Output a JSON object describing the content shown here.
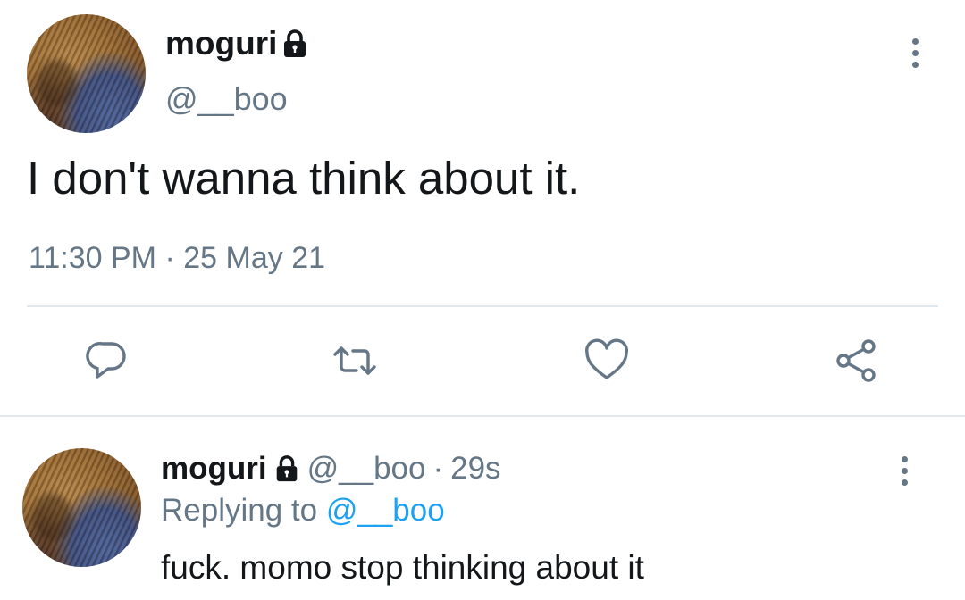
{
  "main_tweet": {
    "name": "moguri",
    "handle": "@__boo",
    "text": "I don't wanna think about it.",
    "time": "11:30 PM",
    "separator": "·",
    "date": "25 May 21"
  },
  "actions": {
    "reply_icon": "reply-icon",
    "retweet_icon": "retweet-icon",
    "like_icon": "heart-icon",
    "share_icon": "share-icon"
  },
  "reply_tweet": {
    "name": "moguri",
    "handle": "@__boo",
    "separator": "·",
    "age": "29s",
    "replying_prefix": "Replying to",
    "replying_to": "@__boo",
    "text": "fuck. momo stop thinking about it"
  },
  "colors": {
    "text": "#14171a",
    "secondary": "#657786",
    "link": "#1da1f2",
    "divider": "#e1e8ed"
  }
}
